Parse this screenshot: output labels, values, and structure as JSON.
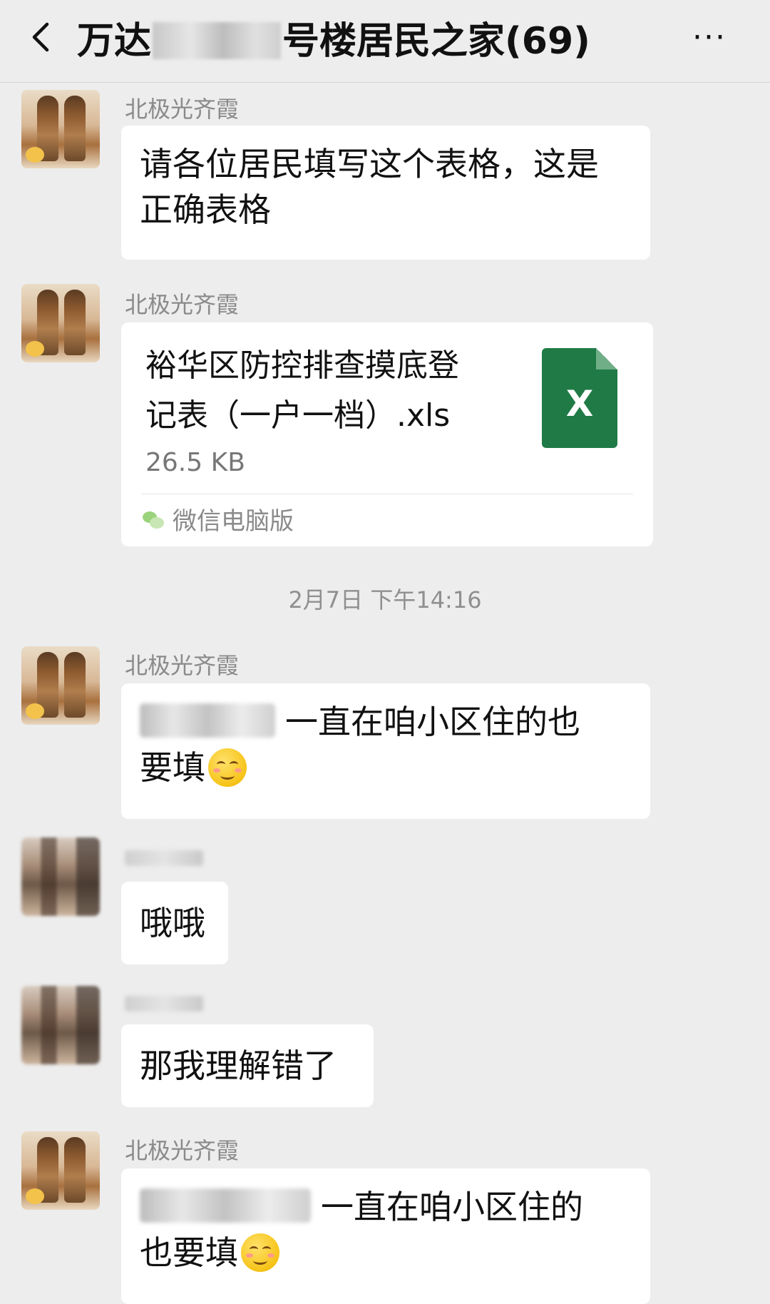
{
  "header": {
    "title_prefix": "万达",
    "title_suffix": "号楼居民之家(69)",
    "back_icon": "chevron-left-icon",
    "more_label": "···"
  },
  "messages": [
    {
      "sender": "北极光齐霞",
      "lines": [
        "请各位居民填写这个表格，这是",
        "正确表格"
      ]
    },
    {
      "sender": "北极光齐霞",
      "file": {
        "name_lines": [
          "裕华区防控排查摸底登",
          "记表（一户一档）.xls"
        ],
        "size": "26.5 KB",
        "icon_letter": "X",
        "source": "微信电脑版"
      }
    },
    {
      "timestamp": "2月7日 下午14:16"
    },
    {
      "sender": "北极光齐霞",
      "line1_suffix": "一直在咱小区住的也",
      "line2": "要填"
    },
    {
      "lines": [
        "哦哦"
      ]
    },
    {
      "lines": [
        "那我理解错了"
      ]
    },
    {
      "sender": "北极光齐霞",
      "line1_suffix": "一直在咱小区住的",
      "line2": "也要填"
    }
  ],
  "colors": {
    "background": "#ededed",
    "bubble": "#ffffff",
    "excel_green": "#1f7a46"
  }
}
